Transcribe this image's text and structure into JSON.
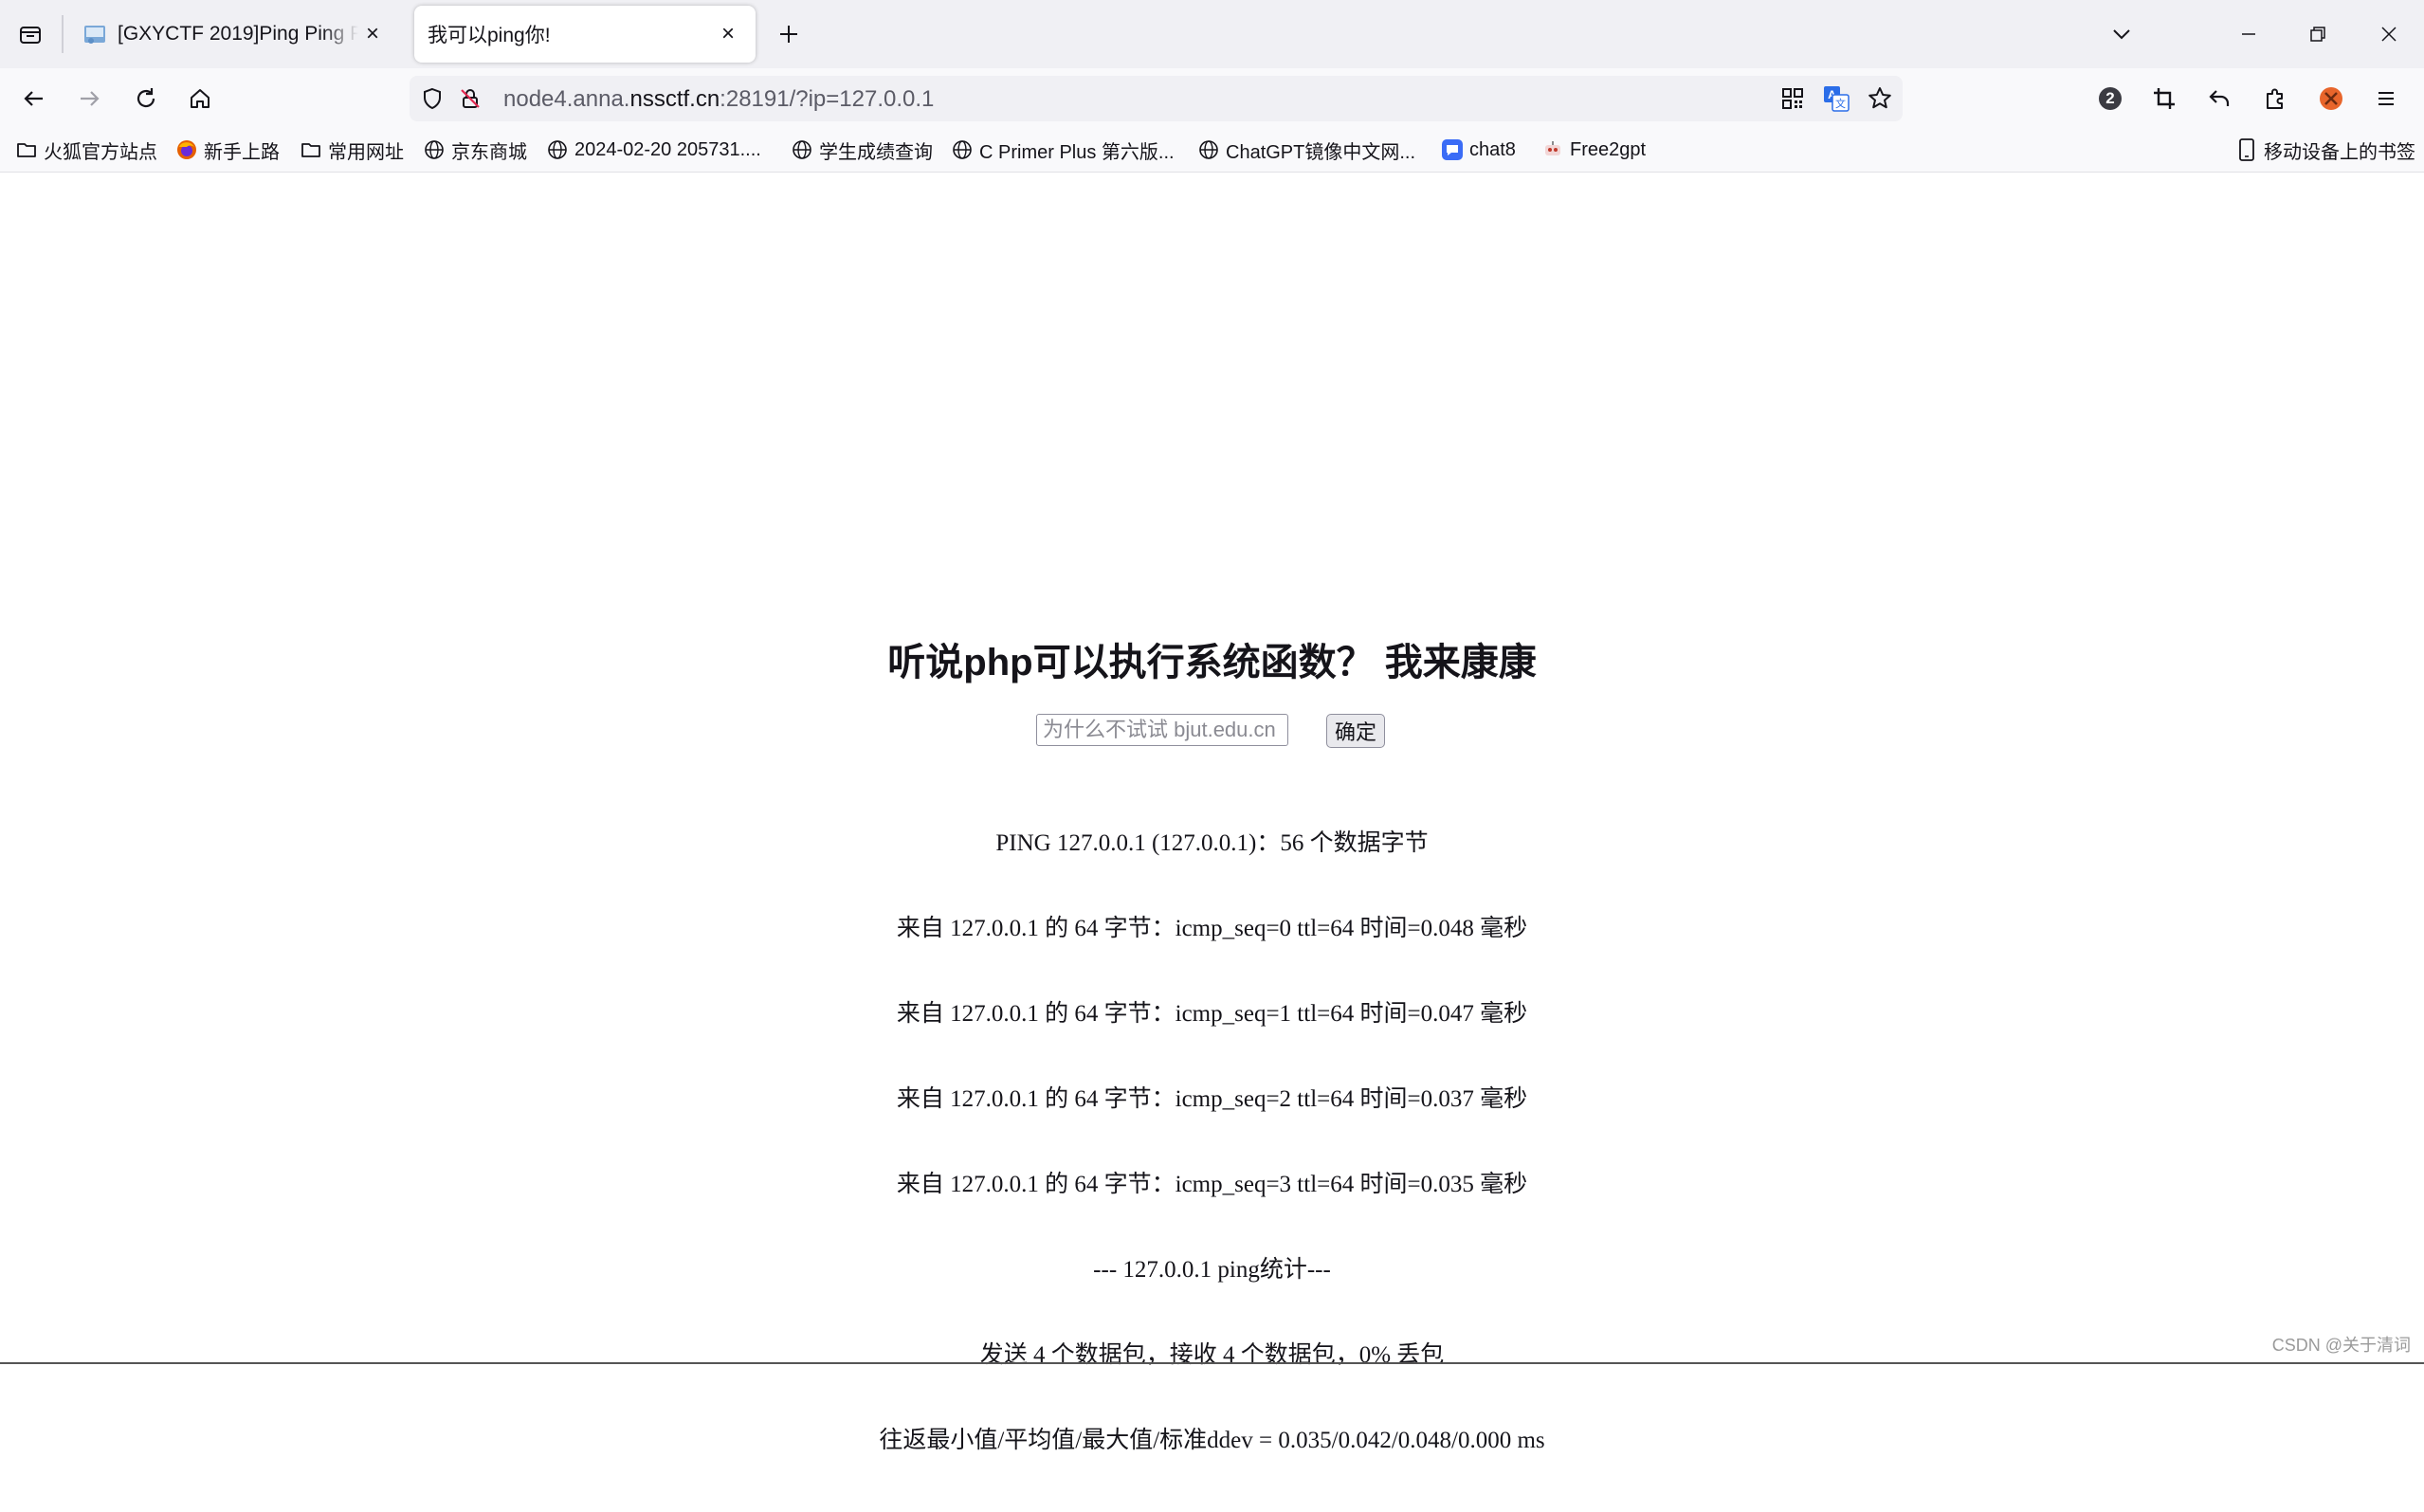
{
  "browser": {
    "tabs": [
      {
        "title": "[GXYCTF 2019]Ping Ping Ping",
        "active": false
      },
      {
        "title": "我可以ping你!",
        "active": true
      }
    ],
    "url": {
      "prefix": "node4.anna.",
      "domain": "nssctf.cn",
      "suffix": ":28191/?ip=127.0.0.1"
    },
    "extension_badge": "2",
    "bookmarks": [
      {
        "label": "火狐官方站点",
        "icon": "folder-icon"
      },
      {
        "label": "新手上路",
        "icon": "firefox-icon"
      },
      {
        "label": "常用网址",
        "icon": "folder-icon"
      },
      {
        "label": "京东商城",
        "icon": "globe-icon"
      },
      {
        "label": "2024-02-20 205731....",
        "icon": "globe-icon"
      },
      {
        "label": "学生成绩查询",
        "icon": "globe-icon"
      },
      {
        "label": "C Primer Plus 第六版...",
        "icon": "globe-icon"
      },
      {
        "label": "ChatGPT镜像中文网...",
        "icon": "globe-icon"
      },
      {
        "label": "chat8",
        "icon": "chat-icon"
      },
      {
        "label": "Free2gpt",
        "icon": "bot-icon"
      }
    ],
    "mobile_bookmarks": "移动设备上的书签"
  },
  "page": {
    "heading": "听说php可以执行系统函数？ 我来康康",
    "input_placeholder": "为什么不试试 bjut.edu.cn",
    "submit_label": "确定",
    "ping_lines": [
      "PING 127.0.0.1 (127.0.0.1)：56 个数据字节",
      "来自 127.0.0.1 的 64 字节：icmp_seq=0 ttl=64 时间=0.048 毫秒",
      "来自 127.0.0.1 的 64 字节：icmp_seq=1 ttl=64 时间=0.047 毫秒",
      "来自 127.0.0.1 的 64 字节：icmp_seq=2 ttl=64 时间=0.037 毫秒",
      "来自 127.0.0.1 的 64 字节：icmp_seq=3 ttl=64 时间=0.035 毫秒",
      "--- 127.0.0.1 ping统计---",
      "发送 4 个数据包，接收 4 个数据包，0% 丢包",
      "往返最小值/平均值/最大值/标准ddev = 0.035/0.042/0.048/0.000 ms"
    ],
    "watermark": "CSDN @关于清词"
  },
  "colors": {
    "tabstrip_bg": "#f0f0f4",
    "toolbar_bg": "#f9f9fb",
    "chat8_blue": "#3b6cf6",
    "translate_blue": "#2b6de8",
    "addon_orange": "#e8652b"
  }
}
